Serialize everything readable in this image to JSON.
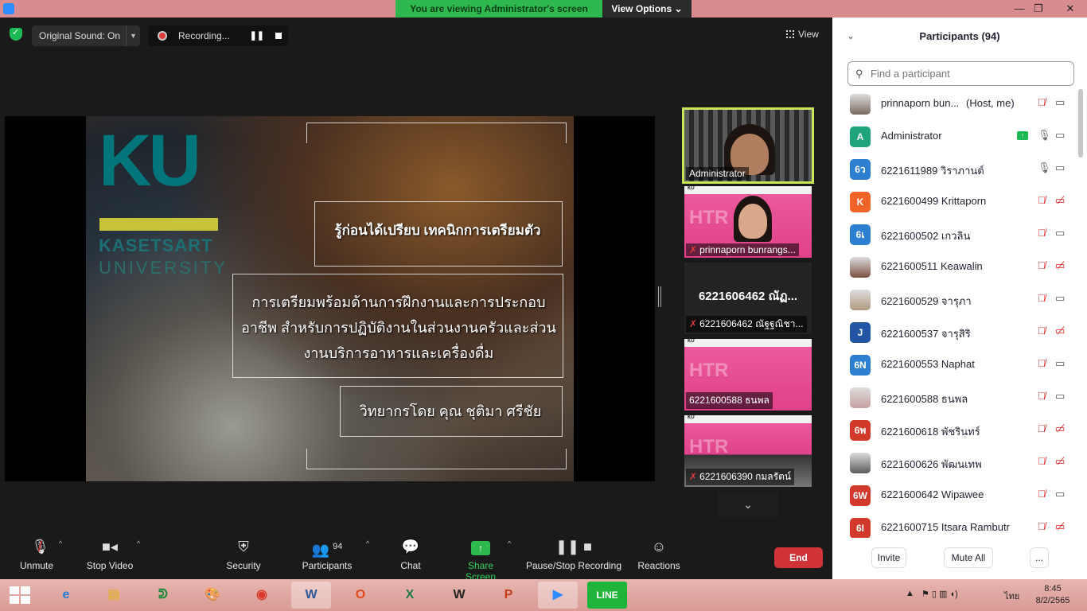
{
  "titlebar": {
    "viewing_banner": "You are viewing Administrator's screen",
    "view_options": "View Options",
    "minimize": "—",
    "restore": "❐",
    "close": "✕"
  },
  "meeting_top": {
    "original_sound": "Original Sound: On",
    "recording": "Recording...",
    "view": "View"
  },
  "slide": {
    "logo_letters": "KU",
    "logo_name": "KASETSART",
    "logo_university": "UNIVERSITY",
    "title": "รู้ก่อนได้เปรียบ เทคนิกการเตรียมตัว",
    "body": "การเตรียมพร้อมด้านการฝึกงานและการประกอบอาชีพ สำหรับการปฏิบัติงานในส่วนงานครัวและส่วนงานบริการอาหารและเครื่องดื่ม",
    "speaker": "วิทยากรโดย คุณ ชุติมา ศรีชัย"
  },
  "thumbnails": [
    {
      "name": "Administrator",
      "muted": false
    },
    {
      "name": "prinnaporn bunrangs...",
      "muted": true
    },
    {
      "big_name": "6221606462 ณัฏ...",
      "name": "6221606462 ณัฐฐณิชา...",
      "muted": true
    },
    {
      "name": "6221600588 ธนพล",
      "muted": false
    },
    {
      "name": "6221606390 กมลรัตน์",
      "muted": true
    }
  ],
  "thumb_slide_text": "HTR",
  "thumb_slide_header": "KU",
  "toolbar": {
    "unmute": "Unmute",
    "stop_video": "Stop Video",
    "security": "Security",
    "participants": "Participants",
    "participants_count": "94",
    "chat": "Chat",
    "share_screen": "Share Screen",
    "pause_stop_recording": "Pause/Stop Recording",
    "reactions": "Reactions",
    "end": "End"
  },
  "panel": {
    "title": "Participants (94)",
    "search_placeholder": "Find a participant",
    "invite": "Invite",
    "mute_all": "Mute All",
    "more": "..."
  },
  "participants": [
    {
      "avatar": "",
      "avatar_color": "#7a6a60",
      "name": "prinnaporn bun...",
      "role": "(Host, me)",
      "mic": "muted",
      "cam": "on"
    },
    {
      "avatar": "A",
      "avatar_color": "#1fa37a",
      "name": "Administrator",
      "role": "",
      "mic": "on",
      "cam": "on",
      "sharing": true
    },
    {
      "avatar": "6ว",
      "avatar_color": "#2d7fd1",
      "name": "6221611989 วิราภานต์",
      "role": "",
      "mic": "on",
      "cam": "on"
    },
    {
      "avatar": "K",
      "avatar_color": "#f0642a",
      "name": "6221600499 Krittaporn",
      "role": "",
      "mic": "muted",
      "cam": "off"
    },
    {
      "avatar": "6เ",
      "avatar_color": "#2d7fd1",
      "name": "6221600502 เกวลิน",
      "role": "",
      "mic": "muted",
      "cam": "on"
    },
    {
      "avatar": "",
      "avatar_color": "#7a5040",
      "name": "6221600511 Keawalin",
      "role": "",
      "mic": "muted",
      "cam": "off"
    },
    {
      "avatar": "",
      "avatar_color": "#b09a80",
      "name": "6221600529 จารุภา",
      "role": "",
      "mic": "muted",
      "cam": "on"
    },
    {
      "avatar": "J",
      "avatar_color": "#2255a4",
      "name": "6221600537 จารุสิริ",
      "role": "",
      "mic": "muted",
      "cam": "off"
    },
    {
      "avatar": "6N",
      "avatar_color": "#2d7fd1",
      "name": "6221600553 Naphat",
      "role": "",
      "mic": "muted",
      "cam": "on"
    },
    {
      "avatar": "",
      "avatar_color": "#c9a0a0",
      "name": "6221600588 ธนพล",
      "role": "",
      "mic": "muted",
      "cam": "on"
    },
    {
      "avatar": "6พ",
      "avatar_color": "#d13a2a",
      "name": "6221600618 พัชรินทร์",
      "role": "",
      "mic": "muted",
      "cam": "off"
    },
    {
      "avatar": "",
      "avatar_color": "#5a5a5a",
      "name": "6221600626 พัฒนเทพ",
      "role": "",
      "mic": "muted",
      "cam": "off"
    },
    {
      "avatar": "6W",
      "avatar_color": "#d13a2a",
      "name": "6221600642 Wipawee",
      "role": "",
      "mic": "muted",
      "cam": "on"
    },
    {
      "avatar": "6I",
      "avatar_color": "#d13a2a",
      "name": "6221600715 Itsara Rambutr",
      "role": "",
      "mic": "muted",
      "cam": "off"
    }
  ],
  "taskbar": {
    "apps": [
      "IE",
      "Files",
      "Line-Green",
      "Paint",
      "Chrome",
      "W",
      "Office",
      "X",
      "Webex",
      "P",
      "Zoom",
      "LINE"
    ],
    "language": "ไทย",
    "time": "8:45",
    "date": "8/2/2565"
  },
  "colors": {
    "accent_green": "#2fb84e",
    "end_red": "#d13438",
    "muted_red": "#e02828",
    "titlebar_pink": "#d98c8f"
  }
}
